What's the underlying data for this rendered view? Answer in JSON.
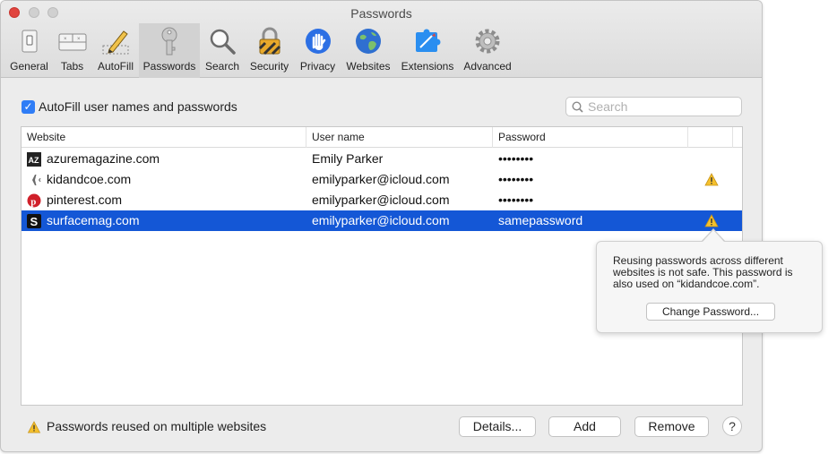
{
  "window": {
    "title": "Passwords"
  },
  "toolbar": {
    "tabs": [
      {
        "label": "General",
        "icon": "switch-icon"
      },
      {
        "label": "Tabs",
        "icon": "tabs-icon"
      },
      {
        "label": "AutoFill",
        "icon": "pencil-icon"
      },
      {
        "label": "Passwords",
        "icon": "key-icon",
        "selected": true
      },
      {
        "label": "Search",
        "icon": "magnifier-icon"
      },
      {
        "label": "Security",
        "icon": "padlock-icon"
      },
      {
        "label": "Privacy",
        "icon": "hand-icon"
      },
      {
        "label": "Websites",
        "icon": "globe-icon"
      },
      {
        "label": "Extensions",
        "icon": "puzzle-icon"
      },
      {
        "label": "Advanced",
        "icon": "gear-icon"
      }
    ]
  },
  "autofill": {
    "label": "AutoFill user names and passwords",
    "checked": true
  },
  "search": {
    "placeholder": "Search",
    "value": ""
  },
  "table": {
    "columns": [
      "Website",
      "User name",
      "Password"
    ],
    "rows": [
      {
        "website": "azuremagazine.com",
        "username": "Emily Parker",
        "password": "••••••••",
        "icon": "az-logo-icon",
        "warning": false,
        "selected": false
      },
      {
        "website": "kidandcoe.com",
        "username": "emilyparker@icloud.com",
        "password": "••••••••",
        "icon": "airplane-icon",
        "warning": true,
        "selected": false
      },
      {
        "website": "pinterest.com",
        "username": "emilyparker@icloud.com",
        "password": "••••••••",
        "icon": "pinterest-icon",
        "warning": false,
        "selected": false
      },
      {
        "website": "surfacemag.com",
        "username": "emilyparker@icloud.com",
        "password": "samepassword",
        "icon": "s-logo-icon",
        "warning": true,
        "selected": true
      }
    ]
  },
  "popover": {
    "message": "Reusing passwords across different websites is not safe. This password is also used on “kidandcoe.com”.",
    "button": "Change Password..."
  },
  "footer": {
    "warning_label": "Passwords reused on multiple websites",
    "details_button": "Details...",
    "add_button": "Add",
    "remove_button": "Remove",
    "help_button": "?"
  },
  "colors": {
    "selection": "#1457d6",
    "checkbox": "#2f7df6",
    "warning": "#f5c02c",
    "close_button": "#e0443e"
  }
}
